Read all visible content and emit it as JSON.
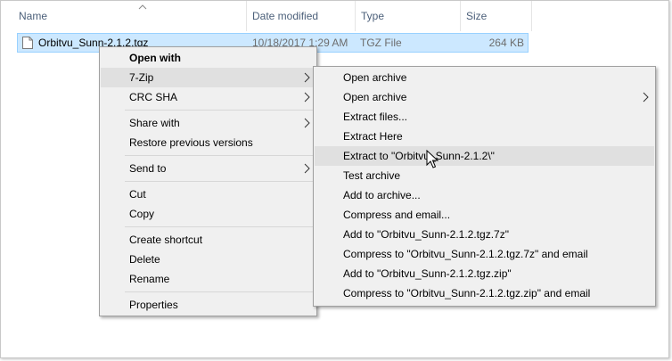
{
  "columns": {
    "name": "Name",
    "date_modified": "Date modified",
    "type": "Type",
    "size": "Size"
  },
  "file": {
    "name": "Orbitvu_Sunn-2.1.2.tgz",
    "date_modified": "10/18/2017 1:29 AM",
    "type": "TGZ File",
    "size": "264 KB"
  },
  "context_menu": [
    {
      "label": "Open with",
      "bold": true
    },
    {
      "label": "7-Zip",
      "submenu": true,
      "highlighted": true
    },
    {
      "label": "CRC SHA",
      "submenu": true
    },
    {
      "label": "Share with",
      "submenu": true
    },
    {
      "label": "Restore previous versions"
    },
    {
      "label": "Send to",
      "submenu": true
    },
    {
      "label": "Cut"
    },
    {
      "label": "Copy"
    },
    {
      "label": "Create shortcut"
    },
    {
      "label": "Delete"
    },
    {
      "label": "Rename"
    },
    {
      "label": "Properties"
    }
  ],
  "submenu_7zip": [
    {
      "label": "Open archive"
    },
    {
      "label": "Open archive",
      "submenu": true
    },
    {
      "label": "Extract files..."
    },
    {
      "label": "Extract Here"
    },
    {
      "label": "Extract to \"Orbitvu_Sunn-2.1.2\\\"",
      "highlighted": true
    },
    {
      "label": "Test archive"
    },
    {
      "label": "Add to archive..."
    },
    {
      "label": "Compress and email..."
    },
    {
      "label": "Add to \"Orbitvu_Sunn-2.1.2.tgz.7z\""
    },
    {
      "label": "Compress to \"Orbitvu_Sunn-2.1.2.tgz.7z\" and email"
    },
    {
      "label": "Add to \"Orbitvu_Sunn-2.1.2.tgz.zip\""
    },
    {
      "label": "Compress to \"Orbitvu_Sunn-2.1.2.tgz.zip\" and email"
    }
  ],
  "icons": {
    "file": "file-icon",
    "sort": "sort-up-icon",
    "submenu": "chevron-right-icon",
    "cursor": "mouse-pointer-icon"
  },
  "colors": {
    "selection": "#cce8ff",
    "selection_border": "#99d1ff",
    "menu_bg": "#f0f0f0",
    "menu_highlight": "#e0e0e0",
    "header_text": "#4c607a"
  }
}
